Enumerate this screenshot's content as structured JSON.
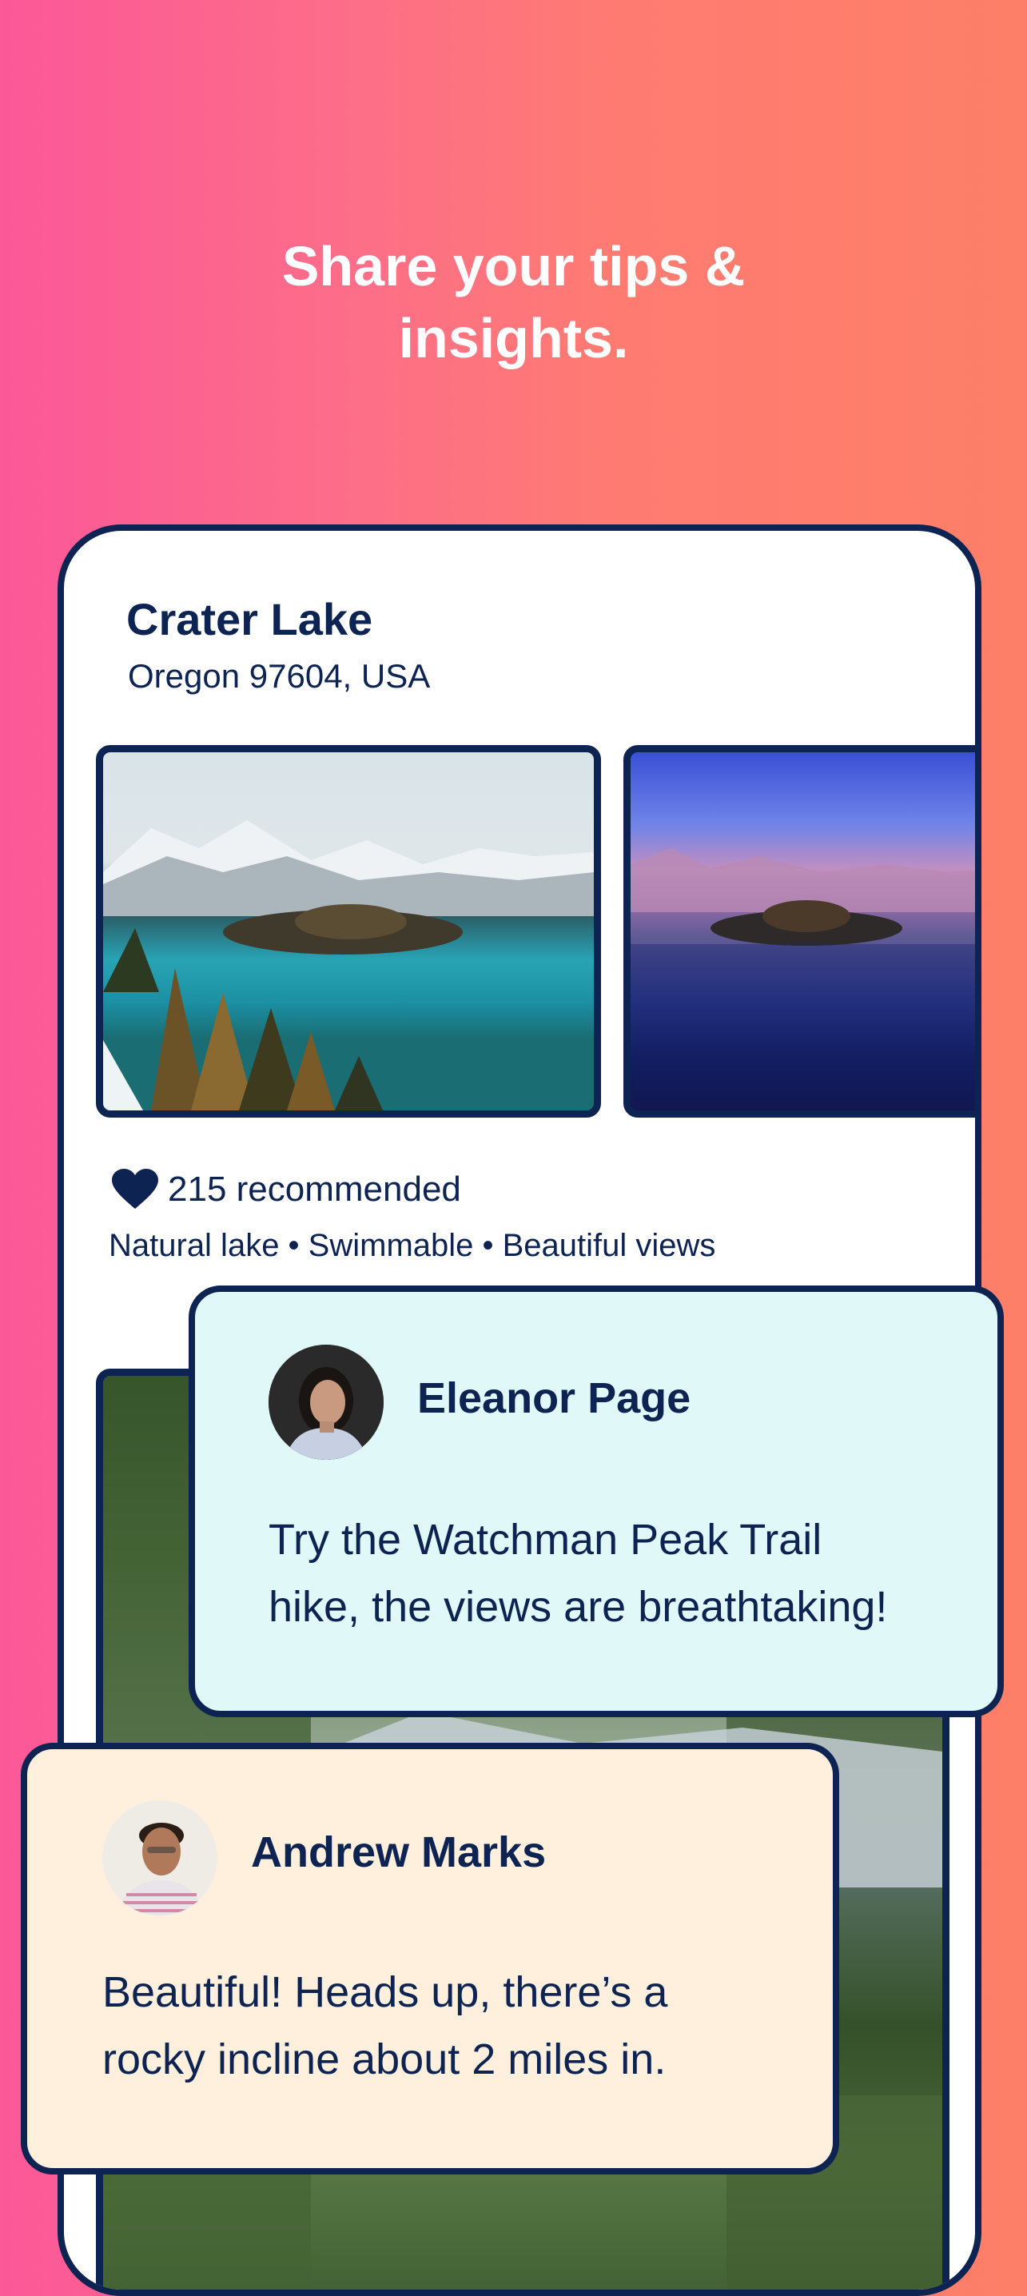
{
  "headline": {
    "line1": "Share your tips &",
    "line2": "insights."
  },
  "place": {
    "title": "Crater Lake",
    "address": "Oregon 97604, USA",
    "recommended": "215 recommended",
    "tags": "Natural lake • Swimmable • Beautiful views",
    "photos": [
      "crater-lake-photo-day",
      "crater-lake-photo-sunset",
      "trail-forest-photo"
    ]
  },
  "comments": [
    {
      "name": "Eleanor Page",
      "line1": "Try the Watchman Peak Trail",
      "line2": "hike, the views are breathtaking!",
      "background": "#e0f8f8"
    },
    {
      "name": "Andrew Marks",
      "line1": "Beautiful! Heads up, there’s a",
      "line2": "rocky incline about 2 miles in.",
      "background": "#fff0de"
    }
  ],
  "colors": {
    "navy": "#0d2352",
    "gradient_left": "#fb5898",
    "gradient_right": "#fd7f67"
  }
}
